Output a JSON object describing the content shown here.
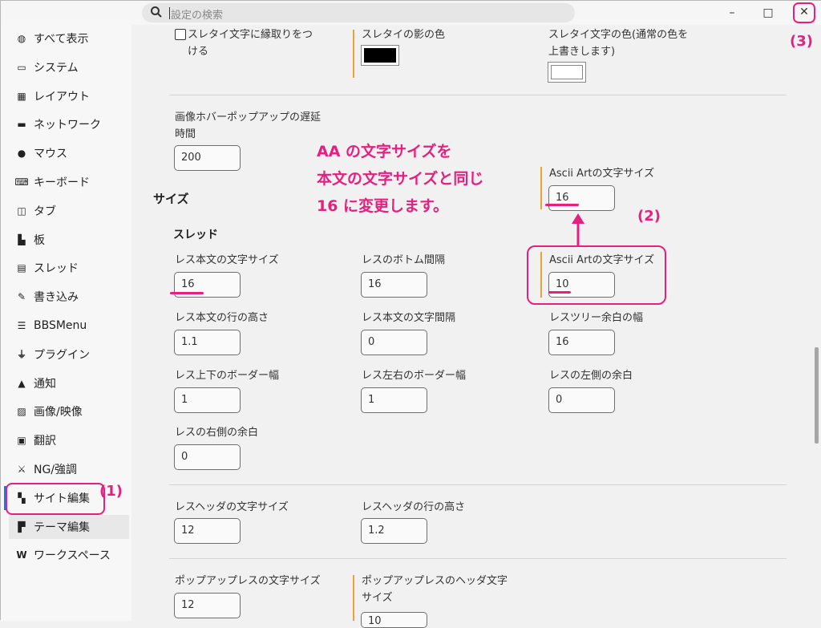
{
  "search": {
    "placeholder": "設定の検索"
  },
  "window": {
    "minimize": "–",
    "maximize": "□",
    "close": "✕"
  },
  "sidebar": {
    "items": [
      {
        "label": "すべて表示",
        "icon": "globe-icon"
      },
      {
        "label": "システム",
        "icon": "monitor-icon"
      },
      {
        "label": "レイアウト",
        "icon": "grid-icon"
      },
      {
        "label": "ネットワーク",
        "icon": "server-icon"
      },
      {
        "label": "マウス",
        "icon": "mouse-icon"
      },
      {
        "label": "キーボード",
        "icon": "keyboard-icon"
      },
      {
        "label": "タブ",
        "icon": "tab-icon"
      },
      {
        "label": "板",
        "icon": "tree-icon"
      },
      {
        "label": "スレッド",
        "icon": "list-icon"
      },
      {
        "label": "書き込み",
        "icon": "edit-icon"
      },
      {
        "label": "BBSMenu",
        "icon": "menu-icon"
      },
      {
        "label": "プラグイン",
        "icon": "plug-icon"
      },
      {
        "label": "通知",
        "icon": "bell-icon"
      },
      {
        "label": "画像/映像",
        "icon": "image-icon"
      },
      {
        "label": "翻訳",
        "icon": "translate-icon"
      },
      {
        "label": "NG/強調",
        "icon": "filter-icon"
      },
      {
        "label": "サイト編集",
        "icon": "site-icon"
      },
      {
        "label": "テーマ編集",
        "icon": "paint-roller-icon"
      },
      {
        "label": "ワークスペース",
        "icon": "workspace-icon"
      }
    ],
    "active_index": 17
  },
  "main": {
    "top_row": {
      "outline_label": "スレタイ文字に縁取りをつ\nける",
      "shadow_color_label": "スレタイの影の色",
      "shadow_color": "#000000",
      "text_color_label": "スレタイ文字の色(通常の色を\n上書きします)",
      "text_color": "#ffffff"
    },
    "hover_delay": {
      "label": "画像ホバーポップアップの遅延\n時間",
      "value": "200"
    },
    "size_heading": "サイズ",
    "ascii_art_top": {
      "label": "Ascii Artの文字サイズ",
      "value": "16"
    },
    "thread_heading": "スレッド",
    "thread_fields": [
      {
        "label": "レス本文の文字サイズ",
        "value": "16"
      },
      {
        "label": "レスのボトム間隔",
        "value": "16"
      },
      {
        "label": "Ascii Artの文字サイズ",
        "value": "10"
      },
      {
        "label": "レス本文の行の高さ",
        "value": "1.1"
      },
      {
        "label": "レス本文の文字間隔",
        "value": "0"
      },
      {
        "label": "レスツリー余白の幅",
        "value": "16"
      },
      {
        "label": "レス上下のボーダー幅",
        "value": "1"
      },
      {
        "label": "レス左右のボーダー幅",
        "value": "1"
      },
      {
        "label": "レスの左側の余白",
        "value": "0"
      },
      {
        "label": "レスの右側の余白",
        "value": "0"
      }
    ],
    "header_fields": [
      {
        "label": "レスヘッダの文字サイズ",
        "value": "12"
      },
      {
        "label": "レスヘッダの行の高さ",
        "value": "1.2"
      }
    ],
    "popup_fields": [
      {
        "label": "ポップアップレスの文字サイズ",
        "value": "12"
      },
      {
        "label": "ポップアップレスのヘッダ文字\nサイズ",
        "value": "10"
      }
    ]
  },
  "annotations": {
    "note_lines": [
      "AA の文字サイズを",
      "本文の文字サイズと同じ",
      "16 に変更します。"
    ],
    "step1": "(1)",
    "step2": "(2)",
    "step3": "(3)",
    "color": "#e5207e"
  }
}
